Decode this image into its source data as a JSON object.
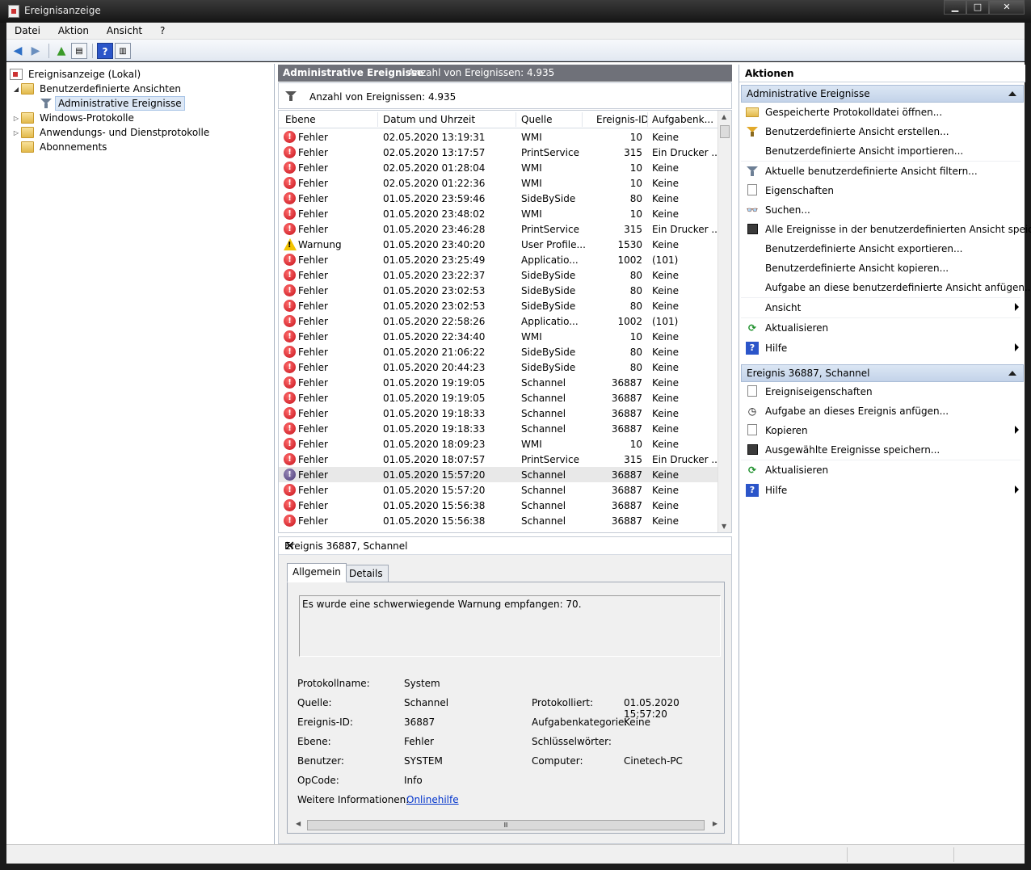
{
  "window": {
    "title": "Ereignisanzeige"
  },
  "menu": [
    "Datei",
    "Aktion",
    "Ansicht",
    "?"
  ],
  "tree": {
    "root": "Ereignisanzeige (Lokal)",
    "custom_views": "Benutzerdefinierte Ansichten",
    "admin_events": "Administrative Ereignisse",
    "windows_logs": "Windows-Protokolle",
    "app_service_logs": "Anwendungs- und Dienstprotokolle",
    "subscriptions": "Abonnements"
  },
  "center": {
    "header_title": "Administrative Ereignisse",
    "header_count": "Anzahl von Ereignissen: 4.935",
    "filter_text": "Anzahl von Ereignissen: 4.935",
    "columns": {
      "level": "Ebene",
      "datetime": "Datum und Uhrzeit",
      "source": "Quelle",
      "event_id": "Ereignis-ID",
      "task": "Aufgabenk..."
    },
    "rows": [
      {
        "type": "error",
        "level": "Fehler",
        "datetime": "02.05.2020 13:19:31",
        "source": "WMI",
        "id": "10",
        "task": "Keine"
      },
      {
        "type": "error",
        "level": "Fehler",
        "datetime": "02.05.2020 13:17:57",
        "source": "PrintService",
        "id": "315",
        "task": "Ein Drucker ..."
      },
      {
        "type": "error",
        "level": "Fehler",
        "datetime": "02.05.2020 01:28:04",
        "source": "WMI",
        "id": "10",
        "task": "Keine"
      },
      {
        "type": "error",
        "level": "Fehler",
        "datetime": "02.05.2020 01:22:36",
        "source": "WMI",
        "id": "10",
        "task": "Keine"
      },
      {
        "type": "error",
        "level": "Fehler",
        "datetime": "01.05.2020 23:59:46",
        "source": "SideBySide",
        "id": "80",
        "task": "Keine"
      },
      {
        "type": "error",
        "level": "Fehler",
        "datetime": "01.05.2020 23:48:02",
        "source": "WMI",
        "id": "10",
        "task": "Keine"
      },
      {
        "type": "error",
        "level": "Fehler",
        "datetime": "01.05.2020 23:46:28",
        "source": "PrintService",
        "id": "315",
        "task": "Ein Drucker ..."
      },
      {
        "type": "warning",
        "level": "Warnung",
        "datetime": "01.05.2020 23:40:20",
        "source": "User Profile...",
        "id": "1530",
        "task": "Keine"
      },
      {
        "type": "error",
        "level": "Fehler",
        "datetime": "01.05.2020 23:25:49",
        "source": "Applicatio...",
        "id": "1002",
        "task": "(101)"
      },
      {
        "type": "error",
        "level": "Fehler",
        "datetime": "01.05.2020 23:22:37",
        "source": "SideBySide",
        "id": "80",
        "task": "Keine"
      },
      {
        "type": "error",
        "level": "Fehler",
        "datetime": "01.05.2020 23:02:53",
        "source": "SideBySide",
        "id": "80",
        "task": "Keine"
      },
      {
        "type": "error",
        "level": "Fehler",
        "datetime": "01.05.2020 23:02:53",
        "source": "SideBySide",
        "id": "80",
        "task": "Keine"
      },
      {
        "type": "error",
        "level": "Fehler",
        "datetime": "01.05.2020 22:58:26",
        "source": "Applicatio...",
        "id": "1002",
        "task": "(101)"
      },
      {
        "type": "error",
        "level": "Fehler",
        "datetime": "01.05.2020 22:34:40",
        "source": "WMI",
        "id": "10",
        "task": "Keine"
      },
      {
        "type": "error",
        "level": "Fehler",
        "datetime": "01.05.2020 21:06:22",
        "source": "SideBySide",
        "id": "80",
        "task": "Keine"
      },
      {
        "type": "error",
        "level": "Fehler",
        "datetime": "01.05.2020 20:44:23",
        "source": "SideBySide",
        "id": "80",
        "task": "Keine"
      },
      {
        "type": "error",
        "level": "Fehler",
        "datetime": "01.05.2020 19:19:05",
        "source": "Schannel",
        "id": "36887",
        "task": "Keine"
      },
      {
        "type": "error",
        "level": "Fehler",
        "datetime": "01.05.2020 19:19:05",
        "source": "Schannel",
        "id": "36887",
        "task": "Keine"
      },
      {
        "type": "error",
        "level": "Fehler",
        "datetime": "01.05.2020 19:18:33",
        "source": "Schannel",
        "id": "36887",
        "task": "Keine"
      },
      {
        "type": "error",
        "level": "Fehler",
        "datetime": "01.05.2020 19:18:33",
        "source": "Schannel",
        "id": "36887",
        "task": "Keine"
      },
      {
        "type": "error",
        "level": "Fehler",
        "datetime": "01.05.2020 18:09:23",
        "source": "WMI",
        "id": "10",
        "task": "Keine"
      },
      {
        "type": "error",
        "level": "Fehler",
        "datetime": "01.05.2020 18:07:57",
        "source": "PrintService",
        "id": "315",
        "task": "Ein Drucker ..."
      },
      {
        "type": "error",
        "level": "Fehler",
        "datetime": "01.05.2020 15:57:20",
        "source": "Schannel",
        "id": "36887",
        "task": "Keine",
        "selected": true
      },
      {
        "type": "error",
        "level": "Fehler",
        "datetime": "01.05.2020 15:57:20",
        "source": "Schannel",
        "id": "36887",
        "task": "Keine"
      },
      {
        "type": "error",
        "level": "Fehler",
        "datetime": "01.05.2020 15:56:38",
        "source": "Schannel",
        "id": "36887",
        "task": "Keine"
      },
      {
        "type": "error",
        "level": "Fehler",
        "datetime": "01.05.2020 15:56:38",
        "source": "Schannel",
        "id": "36887",
        "task": "Keine"
      }
    ]
  },
  "detail": {
    "title": "Ereignis 36887, Schannel",
    "close": "✕",
    "tab_general": "Allgemein",
    "tab_details": "Details",
    "message": "Es wurde eine schwerwiegende Warnung empfangen: 70.",
    "fields": {
      "log_name_label": "Protokollname:",
      "log_name": "System",
      "source_label": "Quelle:",
      "source": "Schannel",
      "logged_label": "Protokolliert:",
      "logged": "01.05.2020 15:57:20",
      "event_id_label": "Ereignis-ID:",
      "event_id": "36887",
      "task_cat_label": "Aufgabenkategorie:",
      "task_cat": "Keine",
      "level_label": "Ebene:",
      "level": "Fehler",
      "keywords_label": "Schlüsselwörter:",
      "user_label": "Benutzer:",
      "user": "SYSTEM",
      "computer_label": "Computer:",
      "computer": "Cinetech-PC",
      "opcode_label": "OpCode:",
      "opcode": "Info",
      "more_info_label": "Weitere Informationen:",
      "more_info_link": "Onlinehilfe"
    }
  },
  "actions": {
    "title": "Aktionen",
    "section1": "Administrative Ereignisse",
    "items1": [
      "Gespeicherte Protokolldatei öffnen...",
      "Benutzerdefinierte Ansicht erstellen...",
      "Benutzerdefinierte Ansicht importieren...",
      "Aktuelle benutzerdefinierte Ansicht filtern...",
      "Eigenschaften",
      "Suchen...",
      "Alle Ereignisse in der benutzerdefinierten Ansicht speic...",
      "Benutzerdefinierte Ansicht exportieren...",
      "Benutzerdefinierte Ansicht kopieren...",
      "Aufgabe an diese benutzerdefinierte Ansicht anfügen...",
      "Ansicht",
      "Aktualisieren",
      "Hilfe"
    ],
    "section2": "Ereignis 36887, Schannel",
    "items2": [
      "Ereigniseigenschaften",
      "Aufgabe an dieses Ereignis anfügen...",
      "Kopieren",
      "Ausgewählte Ereignisse speichern...",
      "Aktualisieren",
      "Hilfe"
    ]
  }
}
